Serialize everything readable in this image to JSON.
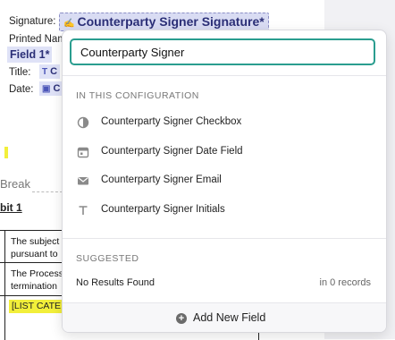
{
  "document": {
    "signature_label": "Signature:",
    "signature_chip": "Counterparty Signer Signature*",
    "printed_name_label": "Printed Nam",
    "field_chip": "Field 1*",
    "title_label": "Title:",
    "title_chip": "C",
    "date_label": "Date:",
    "date_chip": "C",
    "break_text": "Break",
    "exhibit_heading": "bit 1",
    "rows": [
      {
        "line1": "The subject",
        "line2": "pursuant to"
      },
      {
        "line1": "The Process",
        "line2": "termination"
      }
    ],
    "list_category": "[LIST CATE"
  },
  "dropdown": {
    "search_value": "Counterparty Signer",
    "section_config": "IN THIS CONFIGURATION",
    "options": [
      {
        "label": "Counterparty Signer Checkbox",
        "icon": "checkbox-icon"
      },
      {
        "label": "Counterparty Signer Date Field",
        "icon": "calendar-icon"
      },
      {
        "label": "Counterparty Signer Email",
        "icon": "email-icon"
      },
      {
        "label": "Counterparty Signer Initials",
        "icon": "text-icon"
      }
    ],
    "section_suggested": "SUGGESTED",
    "no_results": "No Results Found",
    "records": "in 0 records",
    "add_new": "Add New Field"
  },
  "colors": {
    "accent": "#2a9d8f",
    "chip_bg": "#d9dcf3",
    "highlight": "#f2ef3a"
  }
}
